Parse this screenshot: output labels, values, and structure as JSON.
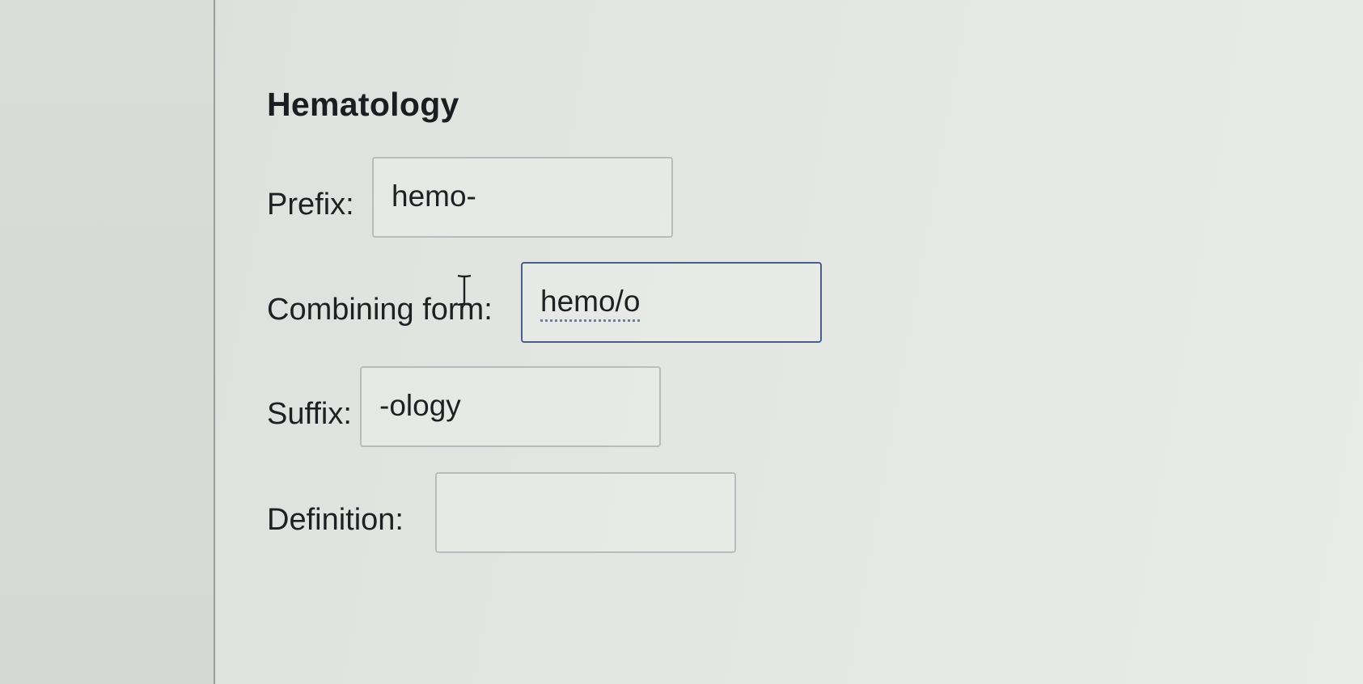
{
  "title": "Hematology",
  "fields": {
    "prefix": {
      "label": "Prefix:",
      "value": "hemo-"
    },
    "combining_form": {
      "label": "Combining form:",
      "value": "hemo/o"
    },
    "suffix": {
      "label": "Suffix:",
      "value": "-ology"
    },
    "definition": {
      "label": "Definition:",
      "value": ""
    }
  },
  "icons": {
    "text_cursor": "i-beam-cursor-icon"
  },
  "colors": {
    "focus_border": "#4a5f86",
    "field_border": "#b9bbbd"
  }
}
